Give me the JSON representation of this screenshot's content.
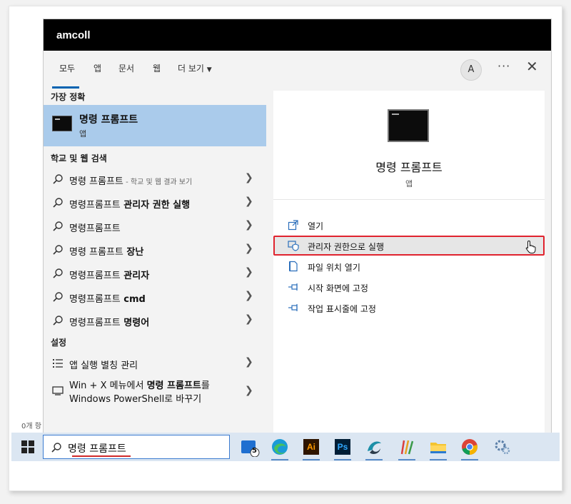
{
  "window": {
    "title": "amcoll"
  },
  "tabs": [
    {
      "label": "모두"
    },
    {
      "label": "앱"
    },
    {
      "label": "문서"
    },
    {
      "label": "웹"
    },
    {
      "label": "더 보기"
    }
  ],
  "header": {
    "avatar_letter": "A",
    "more_label": "···",
    "close_label": "✕"
  },
  "best_match": {
    "heading": "가장 정확",
    "name": "명령 프롬프트",
    "type": "앱"
  },
  "web_search": {
    "heading": "학교 및 웹 검색",
    "items": [
      {
        "label": "명령 프롬프트",
        "hint": " - 학교 및 웹 결과 보기"
      },
      {
        "prefix": "명령프롬프트",
        "bold": " 관리자 권한 실행"
      },
      {
        "prefix": "명령프롬프트",
        "bold": ""
      },
      {
        "prefix": "명령 프롬프트",
        "bold": " 장난"
      },
      {
        "prefix": "명령프롬프트",
        "bold": " 관리자"
      },
      {
        "prefix": "명령프롬프트",
        "bold": " cmd"
      },
      {
        "prefix": "명령프롬프트",
        "bold": " 명령어"
      }
    ]
  },
  "settings": {
    "heading": "설정",
    "items": [
      {
        "label": "앱 실행 별칭 관리",
        "icon": "list-icon"
      },
      {
        "line1_pre": "Win + X 메뉴에서 ",
        "line1_bold": "명령 프롬프트",
        "line1_post": "를",
        "line2": "Windows PowerShell로 바꾸기",
        "icon": "monitor-icon"
      }
    ]
  },
  "preview": {
    "title": "명령 프롬프트",
    "type": "앱",
    "actions": [
      {
        "label": "열기",
        "icon": "open-icon"
      },
      {
        "label": "관리자 권한으로 실행",
        "icon": "shield-icon"
      },
      {
        "label": "파일 위치 열기",
        "icon": "file-icon"
      },
      {
        "label": "시작 화면에 고정",
        "icon": "pin-icon"
      },
      {
        "label": "작업 표시줄에 고정",
        "icon": "pin-icon"
      }
    ]
  },
  "desktop": {
    "status_text": "0개 항"
  },
  "taskbar": {
    "search_value": "명령 프롬프트",
    "apps": [
      {
        "name": "store-app",
        "badge": "5"
      },
      {
        "name": "edge-app"
      },
      {
        "name": "illustrator-app",
        "text": "Ai"
      },
      {
        "name": "photoshop-app",
        "text": "Ps"
      },
      {
        "name": "app-swirl"
      },
      {
        "name": "app-stripes"
      },
      {
        "name": "file-explorer-app"
      },
      {
        "name": "chrome-app"
      },
      {
        "name": "settings-app"
      }
    ]
  },
  "colors": {
    "accent": "#0063b1",
    "selection": "#aacbeb",
    "highlight_border": "#e0232e",
    "taskbar": "#dbe6f2"
  }
}
